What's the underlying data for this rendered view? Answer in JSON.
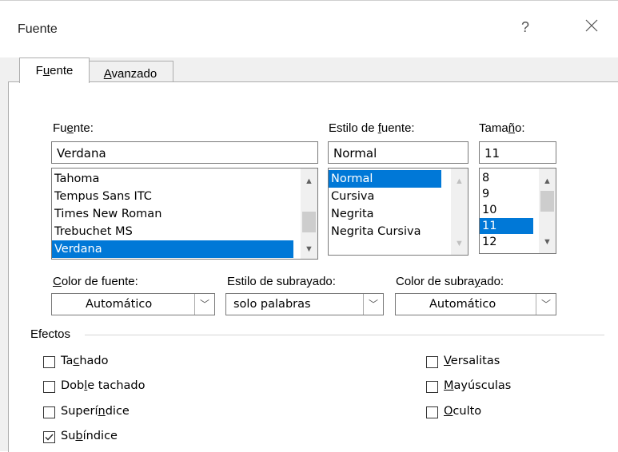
{
  "window": {
    "title": "Fuente",
    "help_glyph": "?"
  },
  "tabs": [
    {
      "pre": "F",
      "ul": "u",
      "post": "ente",
      "active": true
    },
    {
      "pre": "",
      "ul": "A",
      "post": "vanzado",
      "active": false
    }
  ],
  "font": {
    "label_pre": "Fu",
    "label_ul": "e",
    "label_post": "nte:",
    "value": "Verdana",
    "items": [
      "Tahoma",
      "Tempus Sans ITC",
      "Times New Roman",
      "Trebuchet MS",
      "Verdana"
    ],
    "selected": "Verdana"
  },
  "style": {
    "label_pre": "Estilo de ",
    "label_ul": "f",
    "label_post": "uente:",
    "value": "Normal",
    "items": [
      "Normal",
      "Cursiva",
      "Negrita",
      "Negrita Cursiva"
    ],
    "selected": "Normal"
  },
  "size": {
    "label_pre": "Tama",
    "label_ul": "ñ",
    "label_post": "o:",
    "value": "11",
    "items": [
      "8",
      "9",
      "10",
      "11",
      "12"
    ],
    "selected": "11"
  },
  "font_color": {
    "label_pre": "",
    "label_ul": "C",
    "label_post": "olor de fuente:",
    "value": "Automático"
  },
  "underline_style": {
    "label_pre": "Estilo de subrayado:",
    "value": "solo palabras"
  },
  "underline_color": {
    "label_pre": "Color de subra",
    "label_ul": "y",
    "label_post": "ado:",
    "value": "Automático"
  },
  "effects": {
    "heading": "Efectos",
    "left": [
      {
        "pre": "Ta",
        "ul": "c",
        "post": "hado",
        "checked": false
      },
      {
        "pre": "Dob",
        "ul": "l",
        "post": "e tachado",
        "checked": false
      },
      {
        "pre": "Superí",
        "ul": "n",
        "post": "dice",
        "checked": false
      },
      {
        "pre": "Su",
        "ul": "b",
        "post": "índice",
        "checked": true
      }
    ],
    "right": [
      {
        "pre": "",
        "ul": "V",
        "post": "ersalitas",
        "checked": false
      },
      {
        "pre": "",
        "ul": "M",
        "post": "ayúsculas",
        "checked": false
      },
      {
        "pre": "",
        "ul": "O",
        "post": "culto",
        "checked": false
      }
    ]
  },
  "icons": {
    "close": "close-icon",
    "help": "help-icon",
    "dropdown": "chevron-down-icon",
    "check": "checkmark-icon"
  },
  "colors": {
    "selection": "#0078d7",
    "dialog_bg": "#f0f0f0"
  }
}
